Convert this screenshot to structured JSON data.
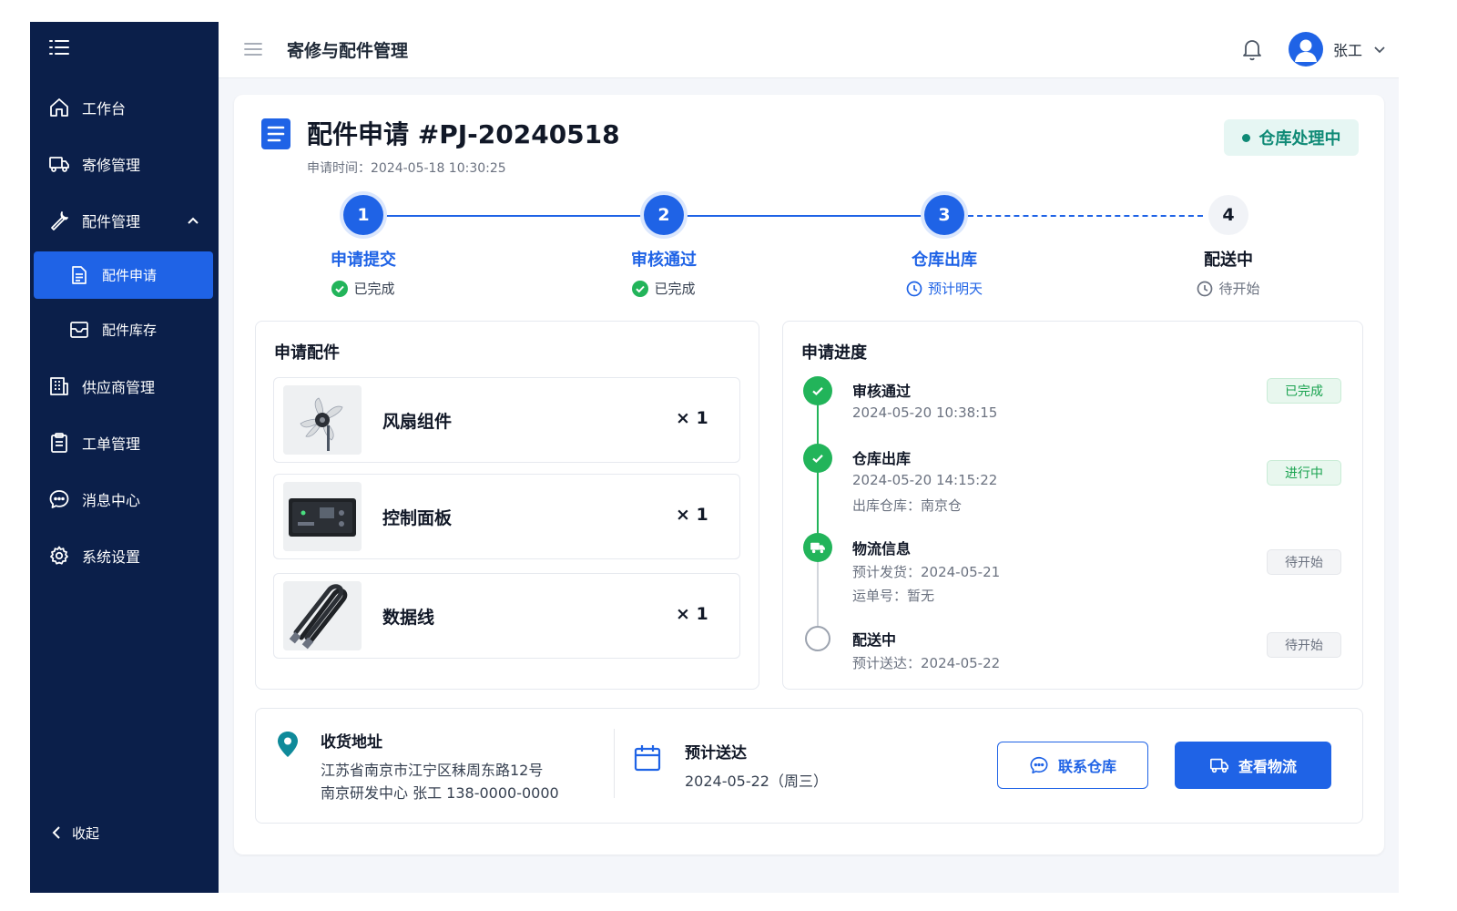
{
  "header": {
    "title": "寄修与配件管理",
    "user_name": "张工"
  },
  "sidebar": {
    "items": [
      {
        "label": "工作台",
        "icon": "home-icon"
      },
      {
        "label": "寄修管理",
        "icon": "truck-icon"
      },
      {
        "label": "配件管理",
        "icon": "wrench-icon"
      },
      {
        "label": "供应商管理",
        "icon": "building-icon"
      },
      {
        "label": "工单管理",
        "icon": "clipboard-icon"
      },
      {
        "label": "消息中心",
        "icon": "chat-icon"
      },
      {
        "label": "系统设置",
        "icon": "gear-icon"
      }
    ],
    "sub_items": [
      {
        "label": "配件申请",
        "icon": "document-icon",
        "active": true
      },
      {
        "label": "配件库存",
        "icon": "inbox-icon",
        "active": false
      }
    ],
    "collapse_label": "收起"
  },
  "request": {
    "title": "配件申请 #PJ-20240518",
    "time": "申请时间：2024-05-18 10:30:25",
    "status": "仓库处理中",
    "status_color": "#0f8a76"
  },
  "steps": [
    {
      "number": "1",
      "name": "申请提交",
      "sub": "已完成",
      "state": "done"
    },
    {
      "number": "2",
      "name": "审核通过",
      "sub": "已完成",
      "state": "done"
    },
    {
      "number": "3",
      "name": "仓库出库",
      "sub": "预计明天",
      "state": "current"
    },
    {
      "number": "4",
      "name": "配送中",
      "sub": "待开始",
      "state": "todo"
    }
  ],
  "parts": {
    "title": "申请配件",
    "items": [
      {
        "name": "风扇组件",
        "qty": "× 1",
        "icon": "fan-image"
      },
      {
        "name": "控制面板",
        "qty": "× 1",
        "icon": "control-panel-image"
      },
      {
        "name": "数据线",
        "qty": "× 1",
        "icon": "cable-image"
      }
    ]
  },
  "progress": {
    "title": "申请进度",
    "events": [
      {
        "title": "审核通过",
        "lines": [
          "2024-05-20 10:38:15"
        ],
        "badge": "已完成",
        "badge_style": "green"
      },
      {
        "title": "仓库出库",
        "lines": [
          "2024-05-20 14:15:22",
          "出库仓库：南京仓"
        ],
        "badge": "进行中",
        "badge_style": "green"
      },
      {
        "title": "物流信息",
        "lines": [
          "预计发货：2024-05-21",
          "运单号：暂无"
        ],
        "badge": "待开始",
        "badge_style": "grey"
      },
      {
        "title": "配送中",
        "lines": [
          "预计送达：2024-05-22"
        ],
        "badge": "待开始",
        "badge_style": "grey"
      }
    ]
  },
  "delivery": {
    "address_title": "收货地址",
    "address_line1": "江苏省南京市江宁区秣周东路12号",
    "address_line2": "南京研发中心 张工 138-0000-0000",
    "eta_title": "预计送达",
    "eta_value": "2024-05-22（周三）",
    "contact_button": "联系仓库",
    "logistics_button": "查看物流"
  },
  "colors": {
    "primary": "#1f63e6",
    "sidebar_bg": "#0b1f4a",
    "success": "#22b45a"
  }
}
